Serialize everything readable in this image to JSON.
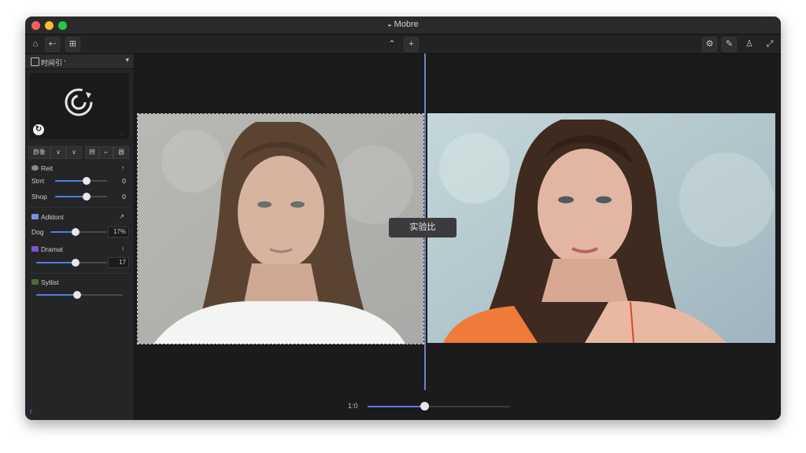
{
  "window": {
    "title": "Mobre"
  },
  "toolbar": {
    "left_buttons": [
      "home-icon",
      "back-icon",
      "layout-icon"
    ],
    "center_buttons": [
      "chevron-up-icon",
      "plus-icon"
    ],
    "right_buttons": [
      "settings-icon",
      "edit-icon",
      "user-icon",
      "expand-icon"
    ]
  },
  "sidebar": {
    "header_label": "时间引 '",
    "segments": [
      "群象",
      "∨",
      "∨",
      "辨",
      "⌐",
      "器"
    ],
    "reset": {
      "label": "Reit",
      "arrow": "↑"
    },
    "sliders_top": [
      {
        "label": "Strrt",
        "value": "0",
        "level": 0.6
      },
      {
        "label": "Shop",
        "value": "0",
        "level": 0.6
      }
    ],
    "section_adjust": {
      "label": "Adldont",
      "arrow": "↗",
      "color": "#7b8fe0"
    },
    "slider_adjust": {
      "label": "Dog",
      "value": "17%",
      "level": 0.45
    },
    "section_dramat": {
      "label": "Dramat",
      "arrow": "↑",
      "color": "#7a55d8"
    },
    "slider_dramat": {
      "value": "17",
      "level": 0.55
    },
    "section_stylist": {
      "label": "Sytlist",
      "color": "#4b6a3e"
    },
    "slider_stylist": {
      "level": 0.47
    },
    "footer": "ℓ"
  },
  "canvas": {
    "compare_label": "实验比",
    "zoom_label": "1:0",
    "zoom_level": 0.4
  },
  "colors": {
    "accent": "#4f7fe0"
  }
}
